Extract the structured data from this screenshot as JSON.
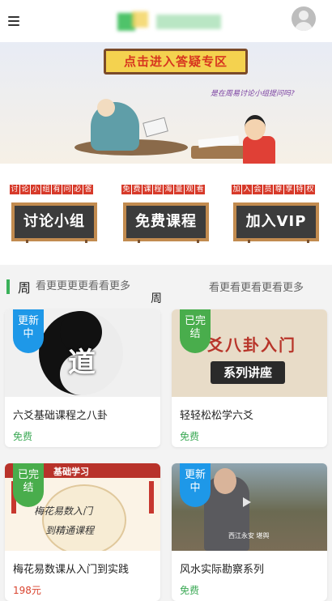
{
  "banner": {
    "sign_text": "点击进入答疑专区",
    "subtext": "是在周易讨论小组提问吗?"
  },
  "categories": [
    {
      "tag": [
        "讨",
        "论",
        "小",
        "组",
        "有",
        "问",
        "必",
        "答"
      ],
      "label": "讨论小组"
    },
    {
      "tag": [
        "免",
        "费",
        "课",
        "程",
        "海",
        "量",
        "观",
        "看"
      ],
      "label": "免费课程"
    },
    {
      "tag": [
        "加",
        "入",
        "会",
        "员",
        "尊",
        "享",
        "特",
        "权"
      ],
      "label": "加入VIP"
    }
  ],
  "section": {
    "title": "周",
    "more_left": "看更更更更看看更多",
    "ghost_title": "周",
    "more_right": "看更看更看更看更多"
  },
  "courses": [
    {
      "badge": "更新中",
      "badge_color": "#1e98e8",
      "title": "六爻基础课程之八卦",
      "price": "免费",
      "thumb_text": "道"
    },
    {
      "badge": "已完结",
      "badge_color": "#49ad4c",
      "title": "轻轻松松学六爻",
      "price": "免费",
      "thumb_heading": "爻八卦入门",
      "thumb_stamp": "系列讲座"
    },
    {
      "badge": "已完结",
      "badge_color": "#49ad4c",
      "title": "梅花易数课从入门到实践",
      "price": "198元",
      "thumb_roof": "基础学习",
      "thumb_line1": "梅花易数入门",
      "thumb_line2": "到精通课程"
    },
    {
      "badge": "更新中",
      "badge_color": "#1e98e8",
      "title": "风水实际勘察系列",
      "price": "免费",
      "thumb_caption": "西江永安 堪舆"
    }
  ]
}
